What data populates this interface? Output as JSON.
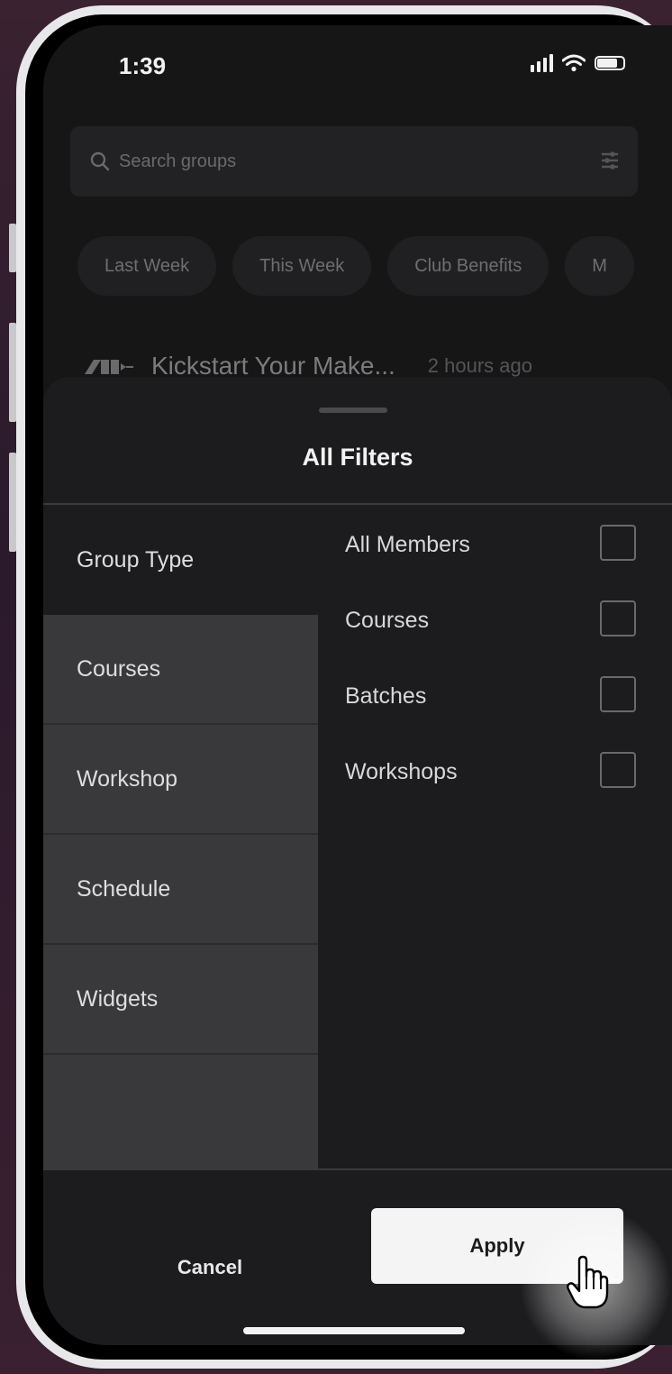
{
  "status_bar": {
    "time": "1:39"
  },
  "search": {
    "placeholder": "Search groups"
  },
  "chips": [
    "Last Week",
    "This Week",
    "Club Benefits",
    "M"
  ],
  "group_row": {
    "name": "Kickstart Your Make...",
    "time": "2 hours ago"
  },
  "sheet": {
    "title": "All Filters",
    "categories": [
      "Group Type",
      "Courses",
      "Workshop",
      "Schedule",
      "Widgets"
    ],
    "active_category": "Group Type",
    "options": [
      {
        "label": "All Members",
        "checked": false
      },
      {
        "label": "Courses",
        "checked": false
      },
      {
        "label": "Batches",
        "checked": false
      },
      {
        "label": "Workshops",
        "checked": false
      }
    ],
    "cancel_label": "Cancel",
    "apply_label": "Apply"
  },
  "colors": {
    "background": "#161617",
    "sheet": "#1c1c1e",
    "category_panel": "#39393c",
    "apply_button": "#f4f4f4"
  }
}
